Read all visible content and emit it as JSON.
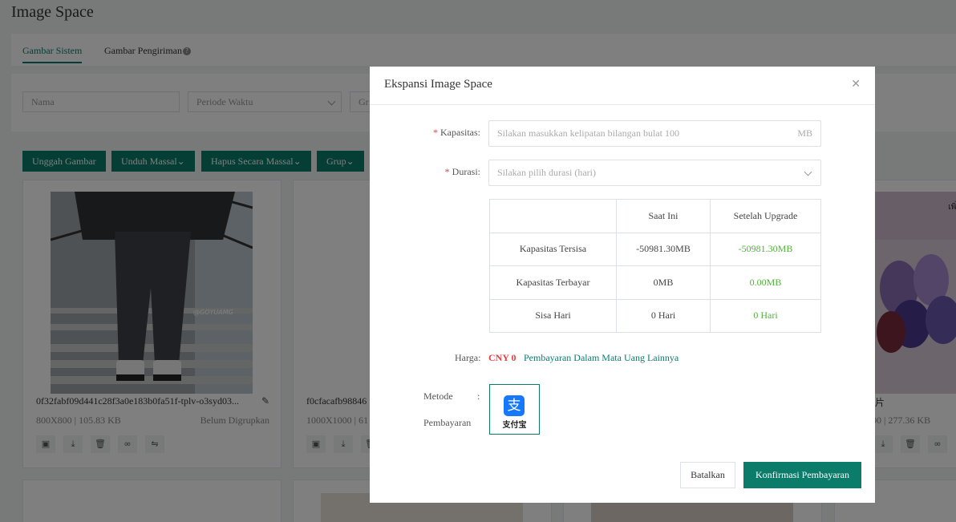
{
  "page": {
    "title": "Image Space"
  },
  "tabs": [
    {
      "label": "Gambar Sistem"
    },
    {
      "label": "Gambar Pengiriman"
    }
  ],
  "filters": {
    "name_placeholder": "Nama",
    "period_placeholder": "Periode Waktu",
    "group_placeholder": "Gr"
  },
  "toolbar": {
    "upload": "Unggah Gambar",
    "download": "Unduh Massal",
    "delete": "Hapus Secara Massal",
    "group": "Grup"
  },
  "cards": [
    {
      "name": "0f32fabf09d441c28f3a0e183b0fa51f-tplv-o3syd03...",
      "meta": "800X800 | 105.83 KB",
      "status": "Belum Digrupkan",
      "watermark": "@GOYUAMG"
    },
    {
      "name": "f0cfacafb98846",
      "meta": "1000X1000 | 61"
    },
    {
      "name": "片",
      "meta": "00 | 277.36 KB",
      "img_text": "เพิ่ม"
    }
  ],
  "modal": {
    "title": "Ekspansi Image Space",
    "capacity_label": "Kapasitas:",
    "capacity_placeholder": "Silakan masukkan kelipatan bilangan bulat 100",
    "capacity_unit": "MB",
    "duration_label": "Durasi:",
    "duration_placeholder": "Silakan pilih durasi (hari)",
    "table": {
      "headers": [
        "",
        "Saat Ini",
        "Setelah Upgrade"
      ],
      "rows": [
        {
          "label": "Kapasitas Tersisa",
          "current": "-50981.30MB",
          "after": "-50981.30MB"
        },
        {
          "label": "Kapasitas Terbayar",
          "current": "0MB",
          "after": "0.00MB"
        },
        {
          "label": "Sisa Hari",
          "current": "0 Hari",
          "after": "0 Hari"
        }
      ]
    },
    "price_label": "Harga:",
    "price": "CNY 0",
    "other_currency": "Pembayaran Dalam Mata Uang Lainnya",
    "payment_label_1": "Metode",
    "payment_label_2": "Pembayaran",
    "payment_colon": ":",
    "alipay_logo": "支",
    "alipay_text": "支付宝",
    "cancel": "Batalkan",
    "confirm": "Konfirmasi Pembayaran"
  },
  "colors": {
    "brand": "#0b7c6a",
    "price": "#e04040",
    "upgrade_value": "#52b13c",
    "alipay": "#1677ff"
  }
}
